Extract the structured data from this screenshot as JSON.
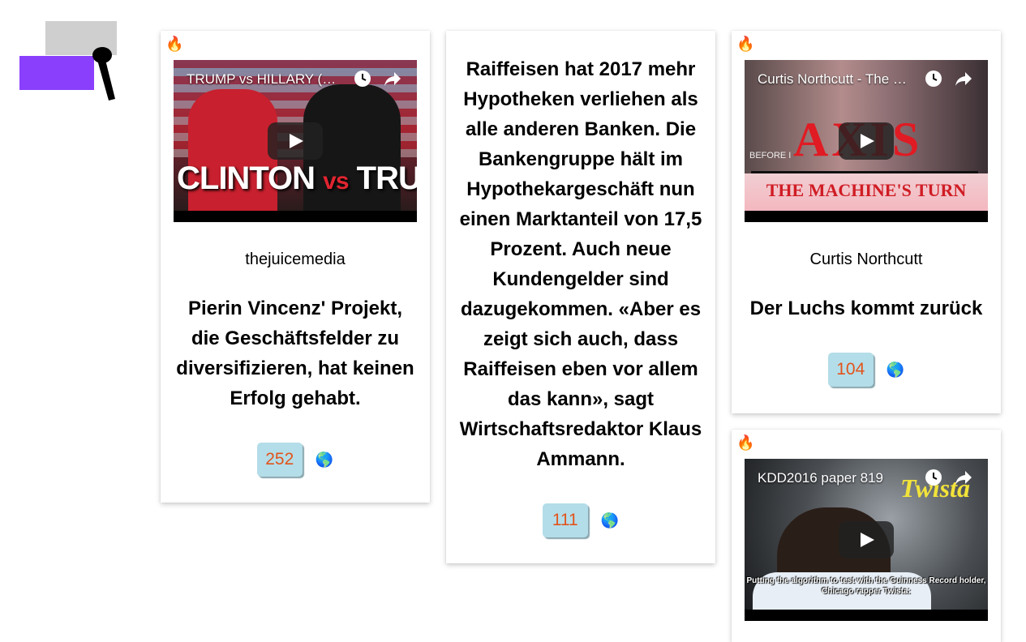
{
  "logo": {
    "name": "mic-logo"
  },
  "icons": {
    "fire": "🔥",
    "globe": "🌎",
    "clock": "clock-icon",
    "share": "share-icon"
  },
  "cards": [
    {
      "video_title": "TRUMP vs HILLARY (R…",
      "thumb_text_left": "CLINTON",
      "thumb_text_vs": "vs",
      "thumb_text_right": "TRUMP",
      "channel": "thejuicemedia",
      "headline": "Pierin Vincenz' Projekt, die Geschäftsfelder zu diversifizieren, hat keinen Erfolg gehabt.",
      "count": "252"
    },
    {
      "headline": "Raiffeisen hat 2017 mehr Hypotheken verliehen als alle anderen Banken. Die Bankengruppe hält im Hypothekargeschäft nun einen Marktanteil von 17,5 Prozent. Auch neue Kundengelder sind dazugekommen. «Aber es zeigt sich auch, dass Raiffeisen eben vor allem das kann», sagt Wirtschaftsredaktor Klaus Ammann.",
      "count": "111"
    },
    {
      "video_title": "Curtis Northcutt - The …",
      "thumb_big": "AXIS",
      "thumb_sub": "THE MACHINE'S TURN",
      "thumb_small": "BEFORE I",
      "channel": "Curtis Northcutt",
      "headline": "Der Luchs kommt zurück",
      "count": "104"
    },
    {
      "video_title": "KDD2016 paper 819",
      "thumb_logo": "Twista",
      "thumb_caption": "Putting the algorithm to test with the Guinness Record holder, Chicago rapper Twista:"
    }
  ]
}
